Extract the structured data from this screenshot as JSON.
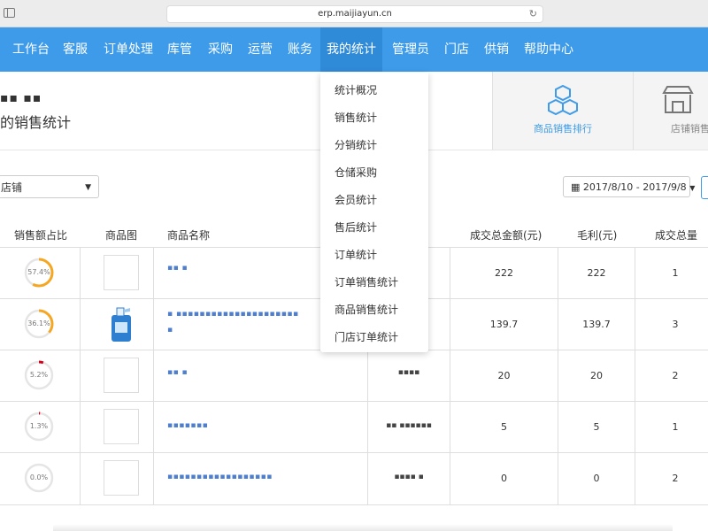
{
  "browser": {
    "url": "erp.maijiayun.cn"
  },
  "nav": {
    "items": [
      {
        "label": "工作台"
      },
      {
        "label": "客服"
      },
      {
        "label": "订单处理"
      },
      {
        "label": "库管"
      },
      {
        "label": "采购"
      },
      {
        "label": "运营"
      },
      {
        "label": "账务"
      },
      {
        "label": "我的统计"
      },
      {
        "label": "管理员"
      },
      {
        "label": "门店"
      },
      {
        "label": "供销"
      },
      {
        "label": "帮助中心"
      }
    ],
    "active": "我的统计",
    "color": "#3d9be9"
  },
  "header": {
    "subtitle": "▪▪ ▪▪",
    "title": "的销售统计",
    "cards": [
      {
        "label": "商品销售排行",
        "icon": "cubes-icon",
        "accent": "#3d9be9"
      },
      {
        "label": "店铺销售",
        "icon": "store-icon"
      }
    ]
  },
  "filters": {
    "store_select": "店铺",
    "date_range": "2017/8/10 - 2017/9/8"
  },
  "table": {
    "columns": [
      "销售额占比",
      "商品图",
      "商品名称",
      "成交总金额(元)",
      "毛利(元)",
      "成交总量"
    ],
    "rows": [
      {
        "percent": "57.4%",
        "pct": 0.574,
        "color": "#f5a623",
        "name": "▪▪ ▪",
        "name2": "",
        "code": "",
        "amount": "222",
        "profit": "222",
        "qty": "1",
        "has_image": false
      },
      {
        "percent": "36.1%",
        "pct": 0.361,
        "color": "#f5a623",
        "name": "▪ ▪▪▪▪▪▪▪▪▪▪▪▪▪▪▪▪▪▪▪▪▪",
        "name2": "▪",
        "code": "",
        "amount": "139.7",
        "profit": "139.7",
        "qty": "3",
        "has_image": true
      },
      {
        "percent": "5.2%",
        "pct": 0.052,
        "color": "#d0021b",
        "name": "▪▪ ▪",
        "name2": "",
        "code": "▪▪▪▪",
        "amount": "20",
        "profit": "20",
        "qty": "2",
        "has_image": false
      },
      {
        "percent": "1.3%",
        "pct": 0.013,
        "color": "#d0021b",
        "name": "▪▪▪▪▪▪▪",
        "name2": "",
        "code": "▪▪ ▪▪▪▪▪▪",
        "amount": "5",
        "profit": "5",
        "qty": "1",
        "has_image": false
      },
      {
        "percent": "0.0%",
        "pct": 0.0,
        "color": "#cccccc",
        "name": "▪▪▪▪▪▪▪▪▪▪▪▪▪▪▪▪▪▪",
        "name2": "",
        "code": "▪▪▪▪ ▪",
        "amount": "0",
        "profit": "0",
        "qty": "2",
        "has_image": false
      }
    ]
  },
  "dropdown": {
    "items": [
      "统计概况",
      "销售统计",
      "分销统计",
      "仓储采购",
      "会员统计",
      "售后统计",
      "订单统计",
      "订单销售统计",
      "商品销售统计",
      "门店订单统计"
    ]
  }
}
